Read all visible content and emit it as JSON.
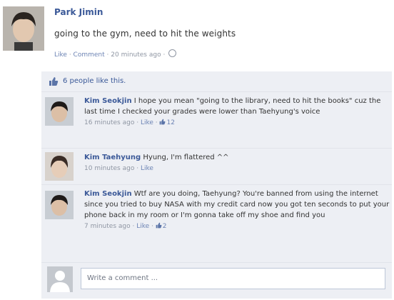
{
  "post": {
    "author": "Park Jimin",
    "status": "going to the gym, need to hit the weights",
    "meta": {
      "like": "Like",
      "sep": " · ",
      "comment": "Comment",
      "time": "20 minutes ago"
    }
  },
  "likes": {
    "text": "6 people like this."
  },
  "comments": [
    {
      "author": "Kim Seokjin",
      "text": "I hope you mean \"going to the library, need to hit the books\" cuz the last time I checked your grades were lower than Taehyung's voice",
      "time": "16 minutes ago",
      "like": "Like",
      "like_count": "12"
    },
    {
      "author": "Kim Taehyung",
      "text": "Hyung, I'm flattered ^^",
      "time": "10 minutes ago",
      "like": "Like",
      "like_count": ""
    },
    {
      "author": "Kim Seokjin",
      "text": "Wtf are you doing, Taehyung? You're banned from using the internet since you tried to buy NASA with my credit card now you got ten seconds to put your phone back in my room or I'm gonna take off my shoe and find you",
      "time": "7 minutes ago",
      "like": "Like",
      "like_count": "2"
    }
  ],
  "composer": {
    "placeholder": "Write a comment ..."
  },
  "colors": {
    "link": "#3b5998",
    "feedback_bg": "#edeff4",
    "meta": "#8f96a3"
  }
}
